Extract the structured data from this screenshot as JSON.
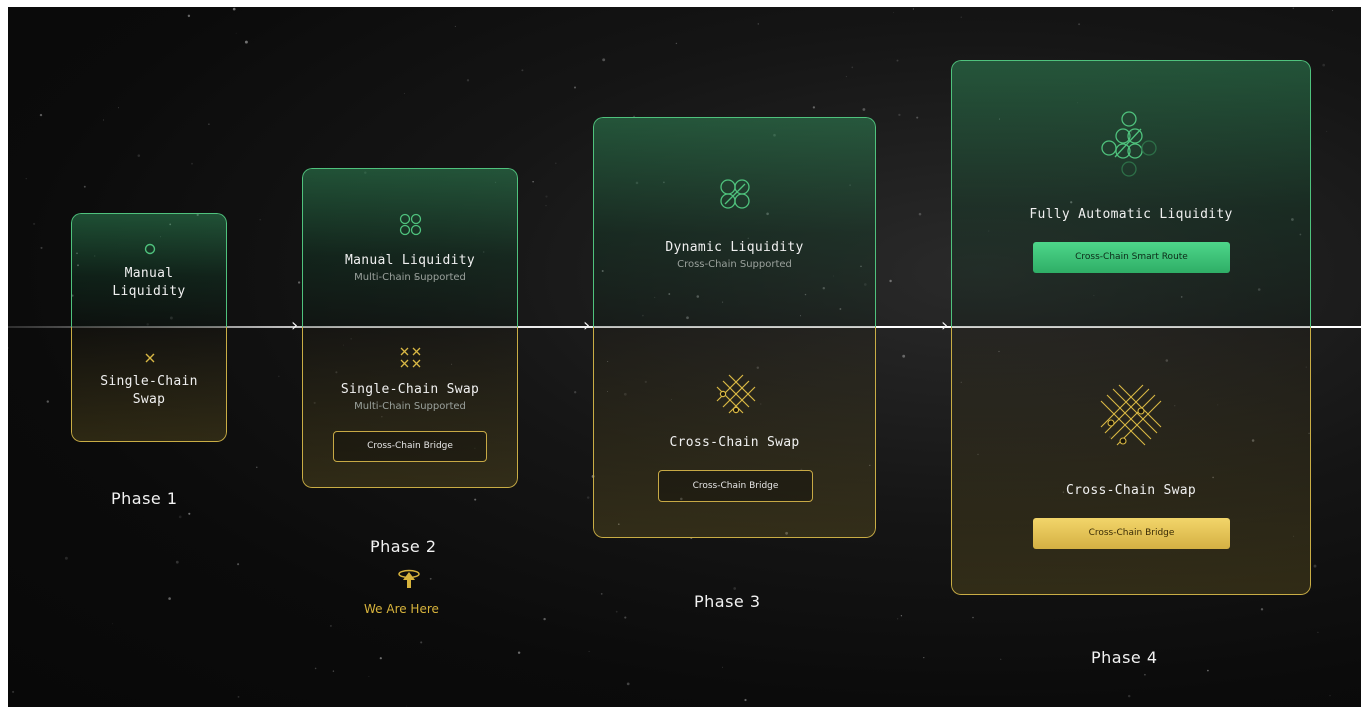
{
  "phases": [
    {
      "label": "Phase 1",
      "liquidity": {
        "title_line1": "Manual",
        "title_line2": "Liquidity"
      },
      "swap": {
        "title_line1": "Single-Chain",
        "title_line2": "Swap"
      }
    },
    {
      "label": "Phase 2",
      "liquidity": {
        "title": "Manual Liquidity",
        "subtitle": "Multi-Chain Supported"
      },
      "swap": {
        "title": "Single-Chain Swap",
        "subtitle": "Multi-Chain Supported",
        "button": "Cross-Chain Bridge"
      },
      "marker": "We Are Here"
    },
    {
      "label": "Phase 3",
      "liquidity": {
        "title": "Dynamic Liquidity",
        "subtitle": "Cross-Chain Supported"
      },
      "swap": {
        "title": "Cross-Chain Swap",
        "button": "Cross-Chain Bridge"
      }
    },
    {
      "label": "Phase 4",
      "liquidity": {
        "title": "Fully Automatic Liquidity",
        "button": "Cross-Chain Smart Route"
      },
      "swap": {
        "title": "Cross-Chain Swap",
        "button": "Cross-Chain Bridge"
      }
    }
  ],
  "colors": {
    "liquidity_accent": "#4fc27d",
    "swap_accent": "#c9ad45",
    "marker_accent": "#d7b33c",
    "background": "#0b0b0b"
  },
  "icons": {
    "phase1_liquidity": "single-circle-icon",
    "phase1_swap": "cross-icon",
    "phase2_liquidity": "four-circles-icon",
    "phase2_swap": "four-crosses-icon",
    "phase3_liquidity": "interlocked-circles-icon",
    "phase3_swap": "lattice-icon",
    "phase4_liquidity": "circle-network-icon",
    "phase4_swap": "large-lattice-icon",
    "marker": "location-arrow-icon"
  }
}
